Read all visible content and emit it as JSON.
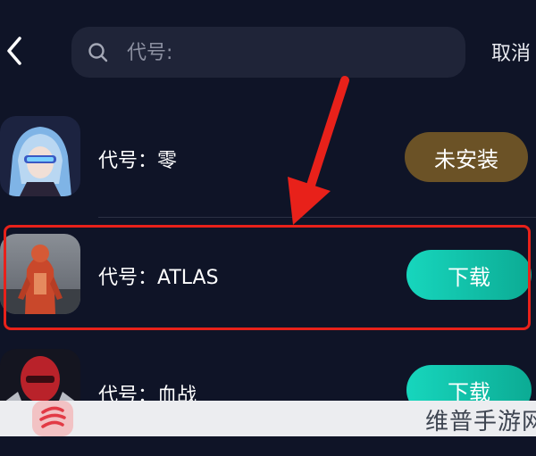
{
  "header": {
    "search_placeholder": "代号:",
    "cancel_label": "取消"
  },
  "results": [
    {
      "name": "代号：零",
      "action": "未安装"
    },
    {
      "name": "代号：ATLAS",
      "action": "下载"
    },
    {
      "name": "代号：血战",
      "action": "下载"
    }
  ],
  "watermark": "维普手游网",
  "colors": {
    "background": "#0f1427",
    "search_bg": "#1f2438",
    "uninstalled_button": "#6b5226",
    "download_button": "#17d6bd",
    "highlight": "#e8211a"
  },
  "icons": [
    "chevron-left-icon",
    "search-icon",
    "arrow-annotation-icon",
    "brand-logo-icon"
  ]
}
